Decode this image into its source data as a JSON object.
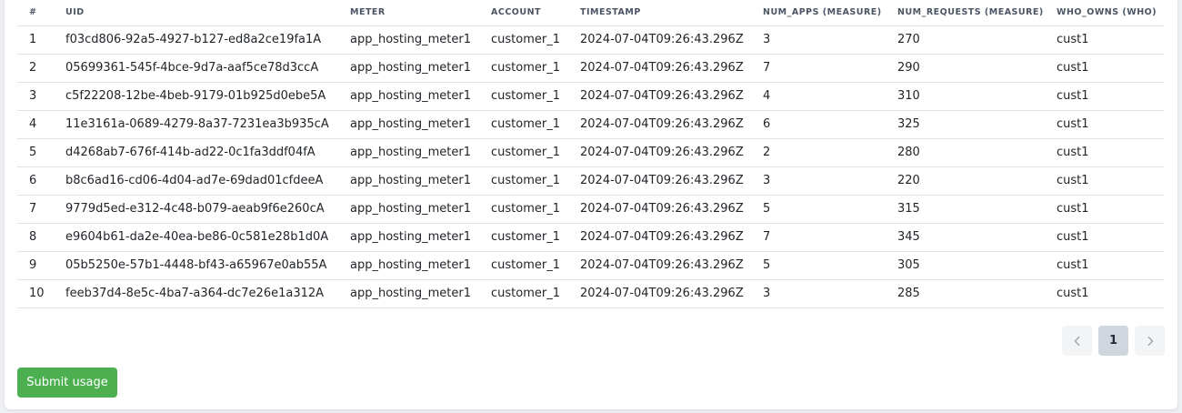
{
  "table": {
    "columns": [
      "#",
      "UID",
      "METER",
      "ACCOUNT",
      "TIMESTAMP",
      "NUM_APPS (MEASURE)",
      "NUM_REQUESTS (MEASURE)",
      "WHO_OWNS (WHO)"
    ],
    "rows": [
      [
        "1",
        "f03cd806-92a5-4927-b127-ed8a2ce19fa1A",
        "app_hosting_meter1",
        "customer_1",
        "2024-07-04T09:26:43.296Z",
        "3",
        "270",
        "cust1"
      ],
      [
        "2",
        "05699361-545f-4bce-9d7a-aaf5ce78d3ccA",
        "app_hosting_meter1",
        "customer_1",
        "2024-07-04T09:26:43.296Z",
        "7",
        "290",
        "cust1"
      ],
      [
        "3",
        "c5f22208-12be-4beb-9179-01b925d0ebe5A",
        "app_hosting_meter1",
        "customer_1",
        "2024-07-04T09:26:43.296Z",
        "4",
        "310",
        "cust1"
      ],
      [
        "4",
        "11e3161a-0689-4279-8a37-7231ea3b935cA",
        "app_hosting_meter1",
        "customer_1",
        "2024-07-04T09:26:43.296Z",
        "6",
        "325",
        "cust1"
      ],
      [
        "5",
        "d4268ab7-676f-414b-ad22-0c1fa3ddf04fA",
        "app_hosting_meter1",
        "customer_1",
        "2024-07-04T09:26:43.296Z",
        "2",
        "280",
        "cust1"
      ],
      [
        "6",
        "b8c6ad16-cd06-4d04-ad7e-69dad01cfdeeA",
        "app_hosting_meter1",
        "customer_1",
        "2024-07-04T09:26:43.296Z",
        "3",
        "220",
        "cust1"
      ],
      [
        "7",
        "9779d5ed-e312-4c48-b079-aeab9f6e260cA",
        "app_hosting_meter1",
        "customer_1",
        "2024-07-04T09:26:43.296Z",
        "5",
        "315",
        "cust1"
      ],
      [
        "8",
        "e9604b61-da2e-40ea-be86-0c581e28b1d0A",
        "app_hosting_meter1",
        "customer_1",
        "2024-07-04T09:26:43.296Z",
        "7",
        "345",
        "cust1"
      ],
      [
        "9",
        "05b5250e-57b1-4448-bf43-a65967e0ab55A",
        "app_hosting_meter1",
        "customer_1",
        "2024-07-04T09:26:43.296Z",
        "5",
        "305",
        "cust1"
      ],
      [
        "10",
        "feeb37d4-8e5c-4ba7-a364-dc7e26e1a312A",
        "app_hosting_meter1",
        "customer_1",
        "2024-07-04T09:26:43.296Z",
        "3",
        "285",
        "cust1"
      ]
    ]
  },
  "pagination": {
    "prev_icon": "chevron-left-icon",
    "current_page": "1",
    "next_icon": "chevron-right-icon"
  },
  "actions": {
    "submit_label": "Submit usage"
  },
  "colors": {
    "submit_button": "#4caf50",
    "active_page": "#cfd6de",
    "row_border": "#dee2e6"
  }
}
